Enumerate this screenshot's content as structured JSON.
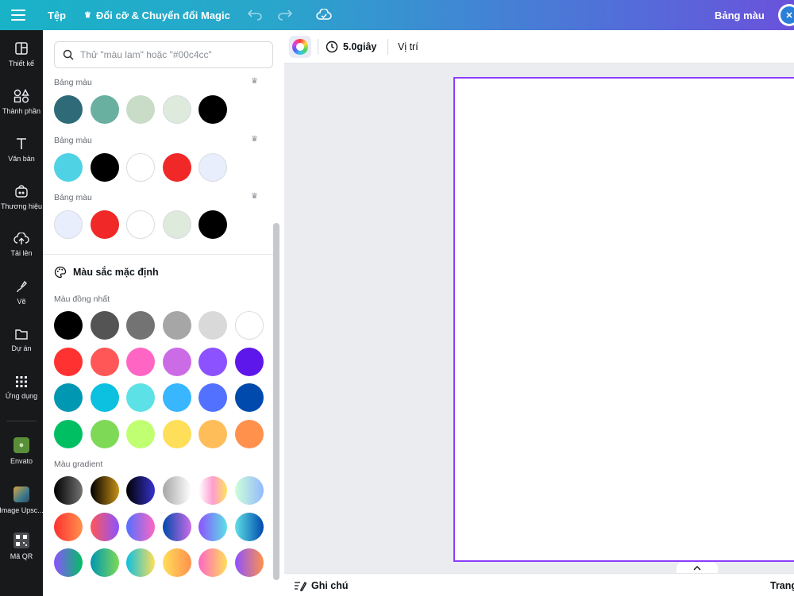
{
  "topbar": {
    "file_label": "Tệp",
    "magic_label": "Đổi cỡ & Chuyển đổi Magic",
    "right_label": "Bảng màu"
  },
  "rail": {
    "items": [
      {
        "label": "Thiết kế",
        "icon": "layout-icon"
      },
      {
        "label": "Thành phần",
        "icon": "elements-icon"
      },
      {
        "label": "Văn bản",
        "icon": "text-icon"
      },
      {
        "label": "Thương hiệu",
        "icon": "brand-icon"
      },
      {
        "label": "Tải lên",
        "icon": "upload-icon"
      },
      {
        "label": "Vẽ",
        "icon": "draw-icon"
      },
      {
        "label": "Dự án",
        "icon": "folder-icon"
      },
      {
        "label": "Ứng dụng",
        "icon": "apps-icon"
      },
      {
        "label": "Envato",
        "icon": "envato-app-icon"
      },
      {
        "label": "Image Upsc...",
        "icon": "image-upscaler-app-icon"
      },
      {
        "label": "Mã QR",
        "icon": "qr-code-app-icon"
      }
    ]
  },
  "panel": {
    "search_placeholder": "Thử \"màu lam\" hoặc \"#00c4cc\"",
    "palettes": [
      {
        "label": "Bảng màu",
        "colors": [
          "#2f6a78",
          "#6ab0a0",
          "#c8dcc8",
          "#deeadc",
          "#000000"
        ]
      },
      {
        "label": "Bảng màu",
        "colors": [
          "#4fd2e4",
          "#000000",
          "#ffffff",
          "#f02828",
          "#e8eefc"
        ]
      },
      {
        "label": "Bảng màu",
        "colors": [
          "#e8eefc",
          "#f02828",
          "#ffffff",
          "#deeadc",
          "#000000"
        ]
      }
    ],
    "default_colors_title": "Màu sắc mặc định",
    "solid_label": "Màu đồng nhất",
    "solid_rows": [
      [
        "#000000",
        "#545454",
        "#737373",
        "#a6a6a6",
        "#d9d9d9",
        "#ffffff"
      ],
      [
        "#ff3131",
        "#ff5757",
        "#ff66c4",
        "#cb6ce6",
        "#8c52ff",
        "#5e17eb"
      ],
      [
        "#0097b2",
        "#0cc0df",
        "#5ce1e6",
        "#38b6ff",
        "#5271ff",
        "#004aad"
      ],
      [
        "#00bf63",
        "#7ed957",
        "#c1ff72",
        "#ffde59",
        "#ffbd59",
        "#ff914d"
      ]
    ],
    "gradient_label": "Màu gradient",
    "gradient_rows": [
      [
        [
          "#000000",
          "#737373"
        ],
        [
          "#000000",
          "#c89116"
        ],
        [
          "#000000",
          "#3533cd"
        ],
        [
          "#a6a6a6",
          "#ffffff"
        ],
        [
          "#ffffff",
          "#fe9ed0",
          "#ffe359"
        ],
        [
          "#cdffd8",
          "#94b9ff"
        ]
      ],
      [
        [
          "#ff3131",
          "#ff914d"
        ],
        [
          "#ff5757",
          "#8c52ff"
        ],
        [
          "#5170ff",
          "#ff66c4"
        ],
        [
          "#004aad",
          "#cb6ce6"
        ],
        [
          "#8c52ff",
          "#5ce1e6"
        ],
        [
          "#5de0e6",
          "#004aad"
        ]
      ],
      [
        [
          "#8c52ff",
          "#00bf63"
        ],
        [
          "#0097b2",
          "#7ed957"
        ],
        [
          "#0cc0df",
          "#ffde59"
        ],
        [
          "#ffde59",
          "#ff914d"
        ],
        [
          "#ff66c4",
          "#ffde59"
        ],
        [
          "#8c52ff",
          "#ff914d"
        ]
      ]
    ]
  },
  "toolbar": {
    "duration": "5.0giây",
    "position": "Vị trí"
  },
  "bottombar": {
    "notes": "Ghi chú",
    "pages": "Trang"
  }
}
